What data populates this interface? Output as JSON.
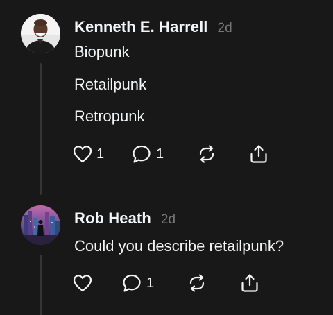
{
  "posts": [
    {
      "author": "Kenneth E. Harrell",
      "timestamp": "2d",
      "lines": [
        "Biopunk",
        "Retailpunk",
        "Retropunk"
      ],
      "likes": "1",
      "replies": "1",
      "icons": [
        "heart-icon",
        "comment-icon",
        "repost-icon",
        "share-icon"
      ]
    },
    {
      "author": "Rob Heath",
      "timestamp": "2d",
      "lines": [
        "Could you describe retailpunk?"
      ],
      "replies": "1",
      "icons": [
        "heart-icon",
        "comment-icon",
        "repost-icon",
        "share-icon"
      ]
    }
  ],
  "colors": {
    "background": "#181818",
    "text": "#f3f5f7",
    "muted": "#777777",
    "thread_line": "#333638"
  }
}
